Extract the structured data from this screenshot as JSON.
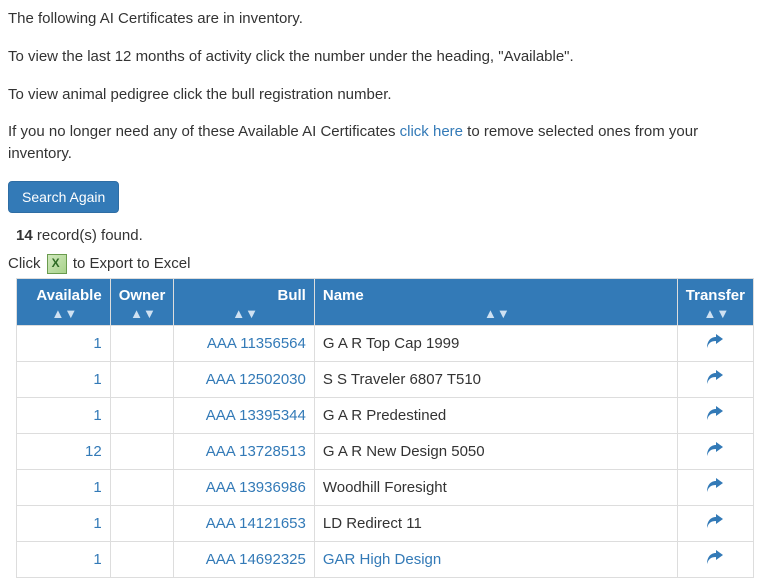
{
  "intro": {
    "p1": "The following AI Certificates are in inventory.",
    "p2": "To view the last 12 months of activity click the number under the heading, \"Available\".",
    "p3": "To view animal pedigree click the bull registration number.",
    "p4_prefix": "If you no longer need any of these Available AI Certificates ",
    "p4_link": "click here",
    "p4_suffix": " to remove selected ones from your inventory."
  },
  "buttons": {
    "search_again": "Search Again"
  },
  "results": {
    "count": "14",
    "found_suffix": " record(s) found."
  },
  "export": {
    "prefix": "Click ",
    "suffix": " to Export to Excel"
  },
  "columns": {
    "available": "Available",
    "owner": "Owner",
    "bull": "Bull",
    "name": "Name",
    "transfer": "Transfer"
  },
  "rows": [
    {
      "available": "1",
      "owner": "",
      "bull": "AAA 11356564",
      "name": "G A R Top Cap 1999"
    },
    {
      "available": "1",
      "owner": "",
      "bull": "AAA 12502030",
      "name": "S S Traveler 6807 T510"
    },
    {
      "available": "1",
      "owner": "",
      "bull": "AAA 13395344",
      "name": "G A R Predestined"
    },
    {
      "available": "12",
      "owner": "",
      "bull": "AAA 13728513",
      "name": "G A R New Design 5050"
    },
    {
      "available": "1",
      "owner": "",
      "bull": "AAA 13936986",
      "name": "Woodhill Foresight"
    },
    {
      "available": "1",
      "owner": "",
      "bull": "AAA 14121653",
      "name": "LD Redirect 11"
    },
    {
      "available": "1",
      "owner": "",
      "bull": "AAA 14692325",
      "name": "GAR High Design"
    }
  ]
}
